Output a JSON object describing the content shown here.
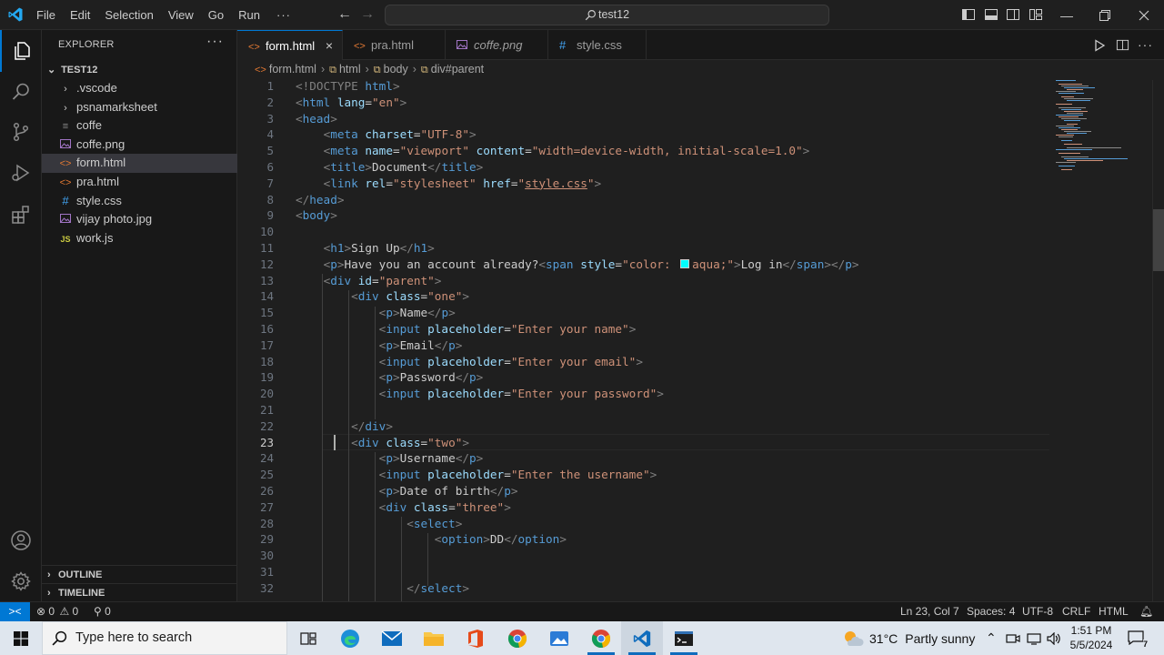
{
  "titlebar": {
    "menu": [
      "File",
      "Edit",
      "Selection",
      "View",
      "Go",
      "Run",
      "···"
    ],
    "search": "test12",
    "window_buttons": [
      "minimize",
      "restore",
      "close"
    ]
  },
  "explorer": {
    "header": "EXPLORER",
    "more": "···",
    "root": "TEST12",
    "items": [
      {
        "label": ".vscode",
        "type": "folder",
        "icon": "chevron-right"
      },
      {
        "label": "psnamarksheet",
        "type": "folder",
        "icon": "chevron-right"
      },
      {
        "label": "coffe",
        "type": "file",
        "icon": "file-lines"
      },
      {
        "label": "coffe.png",
        "type": "image",
        "icon": "image"
      },
      {
        "label": "form.html",
        "type": "html",
        "icon": "html-brackets",
        "selected": true
      },
      {
        "label": "pra.html",
        "type": "html",
        "icon": "html-brackets"
      },
      {
        "label": "style.css",
        "type": "css",
        "icon": "hash"
      },
      {
        "label": "vijay photo.jpg",
        "type": "image",
        "icon": "image"
      },
      {
        "label": "work.js",
        "type": "js",
        "icon": "JS"
      }
    ],
    "outline": "OUTLINE",
    "timeline": "TIMELINE"
  },
  "tabs": [
    {
      "label": "form.html",
      "active": true,
      "icon": "html-brackets",
      "close": "×"
    },
    {
      "label": "pra.html",
      "active": false,
      "icon": "html-brackets"
    },
    {
      "label": "coffe.png",
      "active": false,
      "icon": "image",
      "italic": true
    },
    {
      "label": "style.css",
      "active": false,
      "icon": "hash"
    }
  ],
  "breadcrumb": [
    "form.html",
    "html",
    "body",
    "div#parent"
  ],
  "editor": {
    "current_line": 23,
    "line_numbers": [
      "1",
      "2",
      "3",
      "4",
      "5",
      "6",
      "7",
      "8",
      "9",
      "10",
      "11",
      "12",
      "13",
      "14",
      "15",
      "16",
      "17",
      "18",
      "19",
      "20",
      "21",
      "22",
      "23",
      "24",
      "25",
      "26",
      "27",
      "28",
      "29",
      "30",
      "31",
      "32"
    ],
    "code": {
      "l1_tag": "<!DOCTYPE",
      "l1_html": "html",
      "l2_attr": "lang",
      "l2_val": "\"en\"",
      "l4_attr": "charset",
      "l4_val": "\"UTF-8\"",
      "l5_attr1": "name",
      "l5_val1": "\"viewport\"",
      "l5_attr2": "content",
      "l5_val2": "\"width=device-width, initial-scale=1.0\"",
      "l6_text": "Document",
      "l7_attr1": "rel",
      "l7_val1": "\"stylesheet\"",
      "l7_attr2": "href",
      "l7_val2_q1": "\"",
      "l7_val2": "style.css",
      "l7_val2_q2": "\"",
      "l11_text": "Sign Up",
      "l12_text": "Have you an account already?",
      "l12_attr": "style",
      "l12_val_a": "\"color: ",
      "l12_val_b": "aqua;\"",
      "l12_span_text": "Log in",
      "l13_attr": "id",
      "l13_val": "\"parent\"",
      "l14_attr": "class",
      "l14_val": "\"one\"",
      "l15_text": "Name",
      "l16_attr": "placeholder",
      "l16_val": "\"Enter your name\"",
      "l17_text": "Email",
      "l18_val": "\"Enter your email\"",
      "l19_text": "Password",
      "l20_val": "\"Enter your password\"",
      "l23_val": "\"two\"",
      "l24_text": "Username",
      "l25_val": "\"Enter the username\"",
      "l26_text": "Date of birth",
      "l27_val": "\"three\"",
      "l29_text": "DD"
    }
  },
  "statusbar": {
    "remote": "><",
    "errors": "0",
    "warnings": "0",
    "ports": "0",
    "position": "Ln 23, Col 7",
    "spaces": "Spaces: 4",
    "encoding": "UTF-8",
    "eol": "CRLF",
    "language": "HTML"
  },
  "taskbar": {
    "search_placeholder": "Type here to search",
    "apps": [
      "task-view",
      "edge",
      "mail",
      "file-explorer",
      "office",
      "chrome",
      "photos",
      "chrome-profile",
      "vscode",
      "terminal"
    ],
    "weather_temp": "31°C",
    "weather_text": "Partly sunny",
    "time": "1:51 PM",
    "date": "5/5/2024",
    "notification_count": "7"
  },
  "colors": {
    "accent": "#0078d4",
    "editor_bg": "#1f1f1f",
    "sidebar_bg": "#181818",
    "tag": "#569cd6",
    "attr": "#9cdcfe",
    "string": "#ce9178",
    "swatch_aqua": "#00ffff"
  }
}
